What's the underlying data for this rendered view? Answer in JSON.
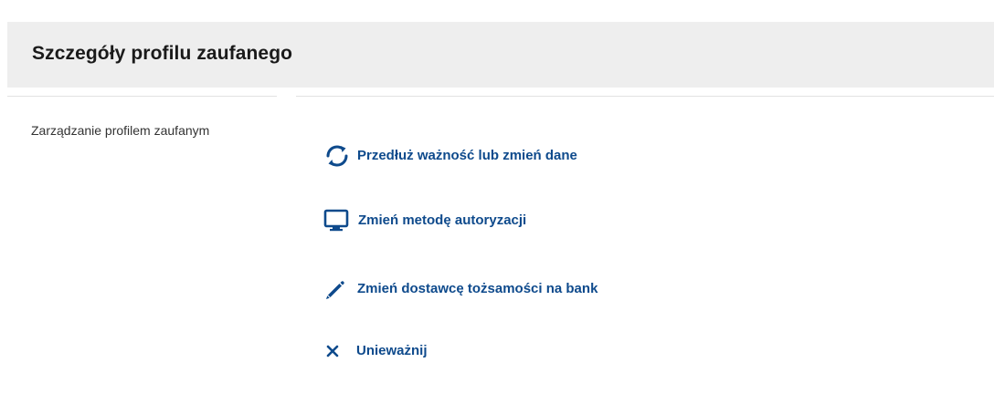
{
  "header": {
    "title": "Szczegóły profilu zaufanego"
  },
  "sidebar": {
    "label": "Zarządzanie profilem zaufanym"
  },
  "actions": [
    {
      "label": "Przedłuż ważność lub zmień dane",
      "icon": "refresh-icon"
    },
    {
      "label": "Zmień metodę autoryzacji",
      "icon": "monitor-icon"
    },
    {
      "label": "Zmień dostawcę tożsamości na bank",
      "icon": "pencil-icon"
    },
    {
      "label": "Unieważnij",
      "icon": "close-icon"
    }
  ],
  "colors": {
    "link": "#0e4a8c",
    "header_bg": "#eeeeee",
    "text": "#1a1a1a"
  }
}
